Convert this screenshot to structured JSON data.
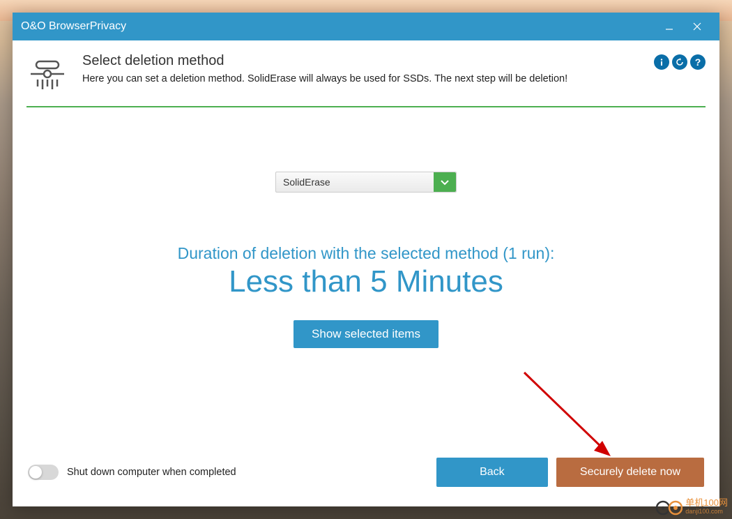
{
  "window": {
    "title": "O&O BrowserPrivacy"
  },
  "header": {
    "title": "Select deletion method",
    "subtitle": "Here you can set a deletion method. SolidErase will always be used for SSDs. The next step will be deletion!"
  },
  "dropdown": {
    "selected": "SolidErase"
  },
  "duration": {
    "label": "Duration of deletion with the selected method (1 run):",
    "value": "Less than 5 Minutes"
  },
  "buttons": {
    "show_items": "Show selected items",
    "back": "Back",
    "delete": "Securely delete now"
  },
  "footer": {
    "shutdown_label": "Shut down computer when completed"
  },
  "watermark": {
    "text": "单机100网",
    "sub": "danji100.com"
  }
}
